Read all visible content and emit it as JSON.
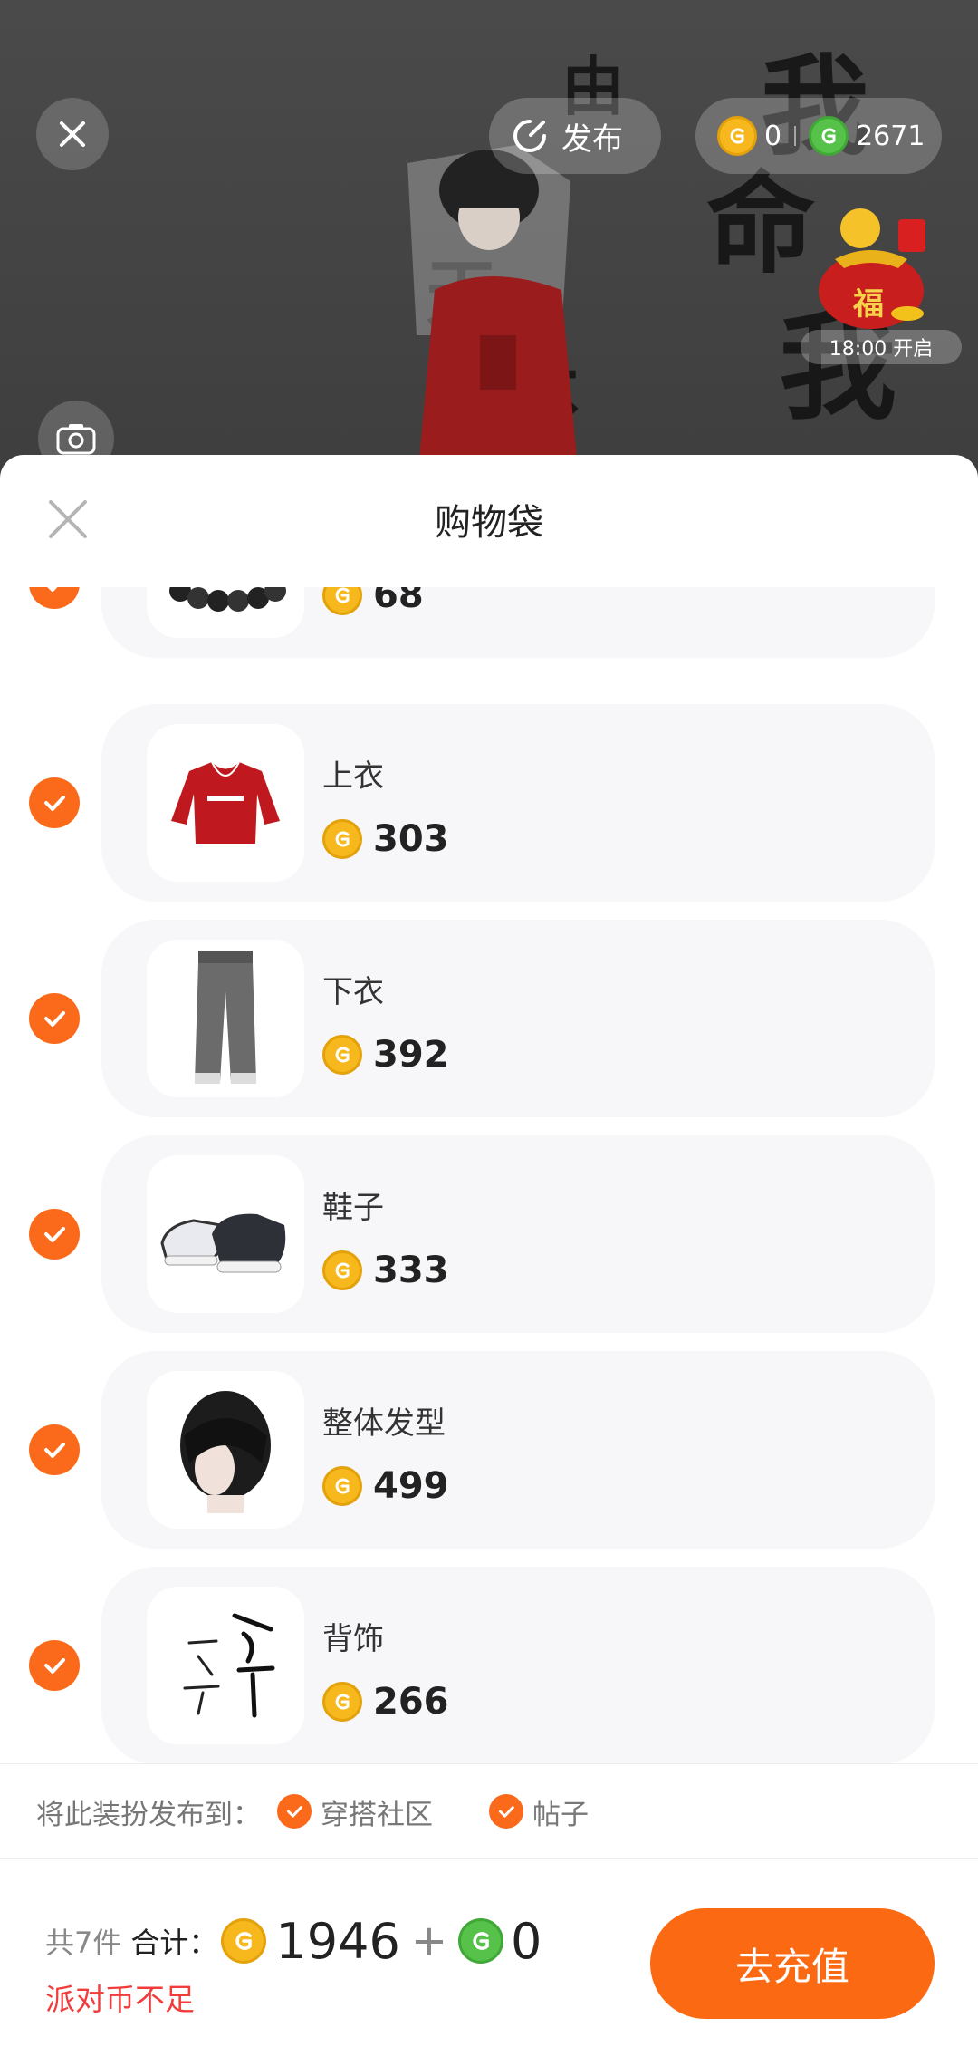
{
  "top_bar": {
    "publish_label": "发布",
    "gold_coin_balance": "0",
    "green_coin_balance": "2671",
    "event_time": "18:00 开启",
    "event_badge_char": "福"
  },
  "sheet": {
    "title": "购物袋",
    "items": [
      {
        "name": "",
        "price": "68",
        "checked": true,
        "thumb": "bracelet"
      },
      {
        "name": "上衣",
        "price": "303",
        "checked": true,
        "thumb": "red-hoodie"
      },
      {
        "name": "下衣",
        "price": "392",
        "checked": true,
        "thumb": "pants"
      },
      {
        "name": "鞋子",
        "price": "333",
        "checked": true,
        "thumb": "sneakers"
      },
      {
        "name": "整体发型",
        "price": "499",
        "checked": true,
        "thumb": "hairstyle"
      },
      {
        "name": "背饰",
        "price": "266",
        "checked": true,
        "thumb": "calligraphy-back"
      }
    ]
  },
  "publish_to": {
    "label": "将此装扮发布到：",
    "options": [
      {
        "label": "穿搭社区",
        "checked": true
      },
      {
        "label": "帖子",
        "checked": true
      }
    ]
  },
  "footer": {
    "count_text": "共7件",
    "total_label": "合计：",
    "gold_total": "1946",
    "plus": "+",
    "green_total": "0",
    "warning": "派对币不足",
    "recharge_button": "去充值"
  },
  "colors": {
    "accent_orange": "#fb6a1a",
    "gold_coin": "#f6b81d",
    "green_coin": "#56c24a",
    "warning_red": "#f23c3c"
  }
}
